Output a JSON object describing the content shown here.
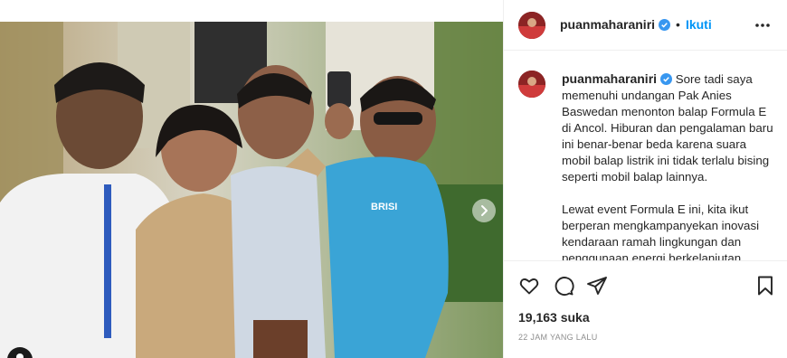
{
  "post": {
    "username": "puanmaharaniri",
    "follow_label": "Ikuti",
    "separator": "•",
    "caption_paragraph_1": "Sore tadi saya memenuhi undangan Pak Anies Baswedan menonton balap Formula E di Ancol. Hiburan dan pengalaman baru ini benar-benar beda karena suara mobil balap listrik ini tidak terlalu bising seperti mobil balap lainnya.",
    "caption_paragraph_2": "Lewat event Formula E ini, kita ikut berperan mengkampanyekan inovasi kendaraan ramah lingkungan dan penggunaan energi berkelanjutan. Saya berharap event internasional ini menarik",
    "likes": "19,163 suka",
    "timestamp": "22 JAM YANG LALU"
  },
  "photo": {
    "shirt_text": "BRISI",
    "carousel_count": 2,
    "carousel_active": 0
  },
  "icons": {
    "verified": "verified-badge-icon",
    "more": "more-options-icon",
    "like": "heart-icon",
    "comment": "comment-icon",
    "share": "share-icon",
    "save": "bookmark-icon",
    "next": "chevron-right-icon",
    "tagged": "user-tag-icon"
  },
  "colors": {
    "accent": "#0095f6",
    "verified": "#3897f0",
    "text": "#262626",
    "muted": "#8e8e8e"
  }
}
